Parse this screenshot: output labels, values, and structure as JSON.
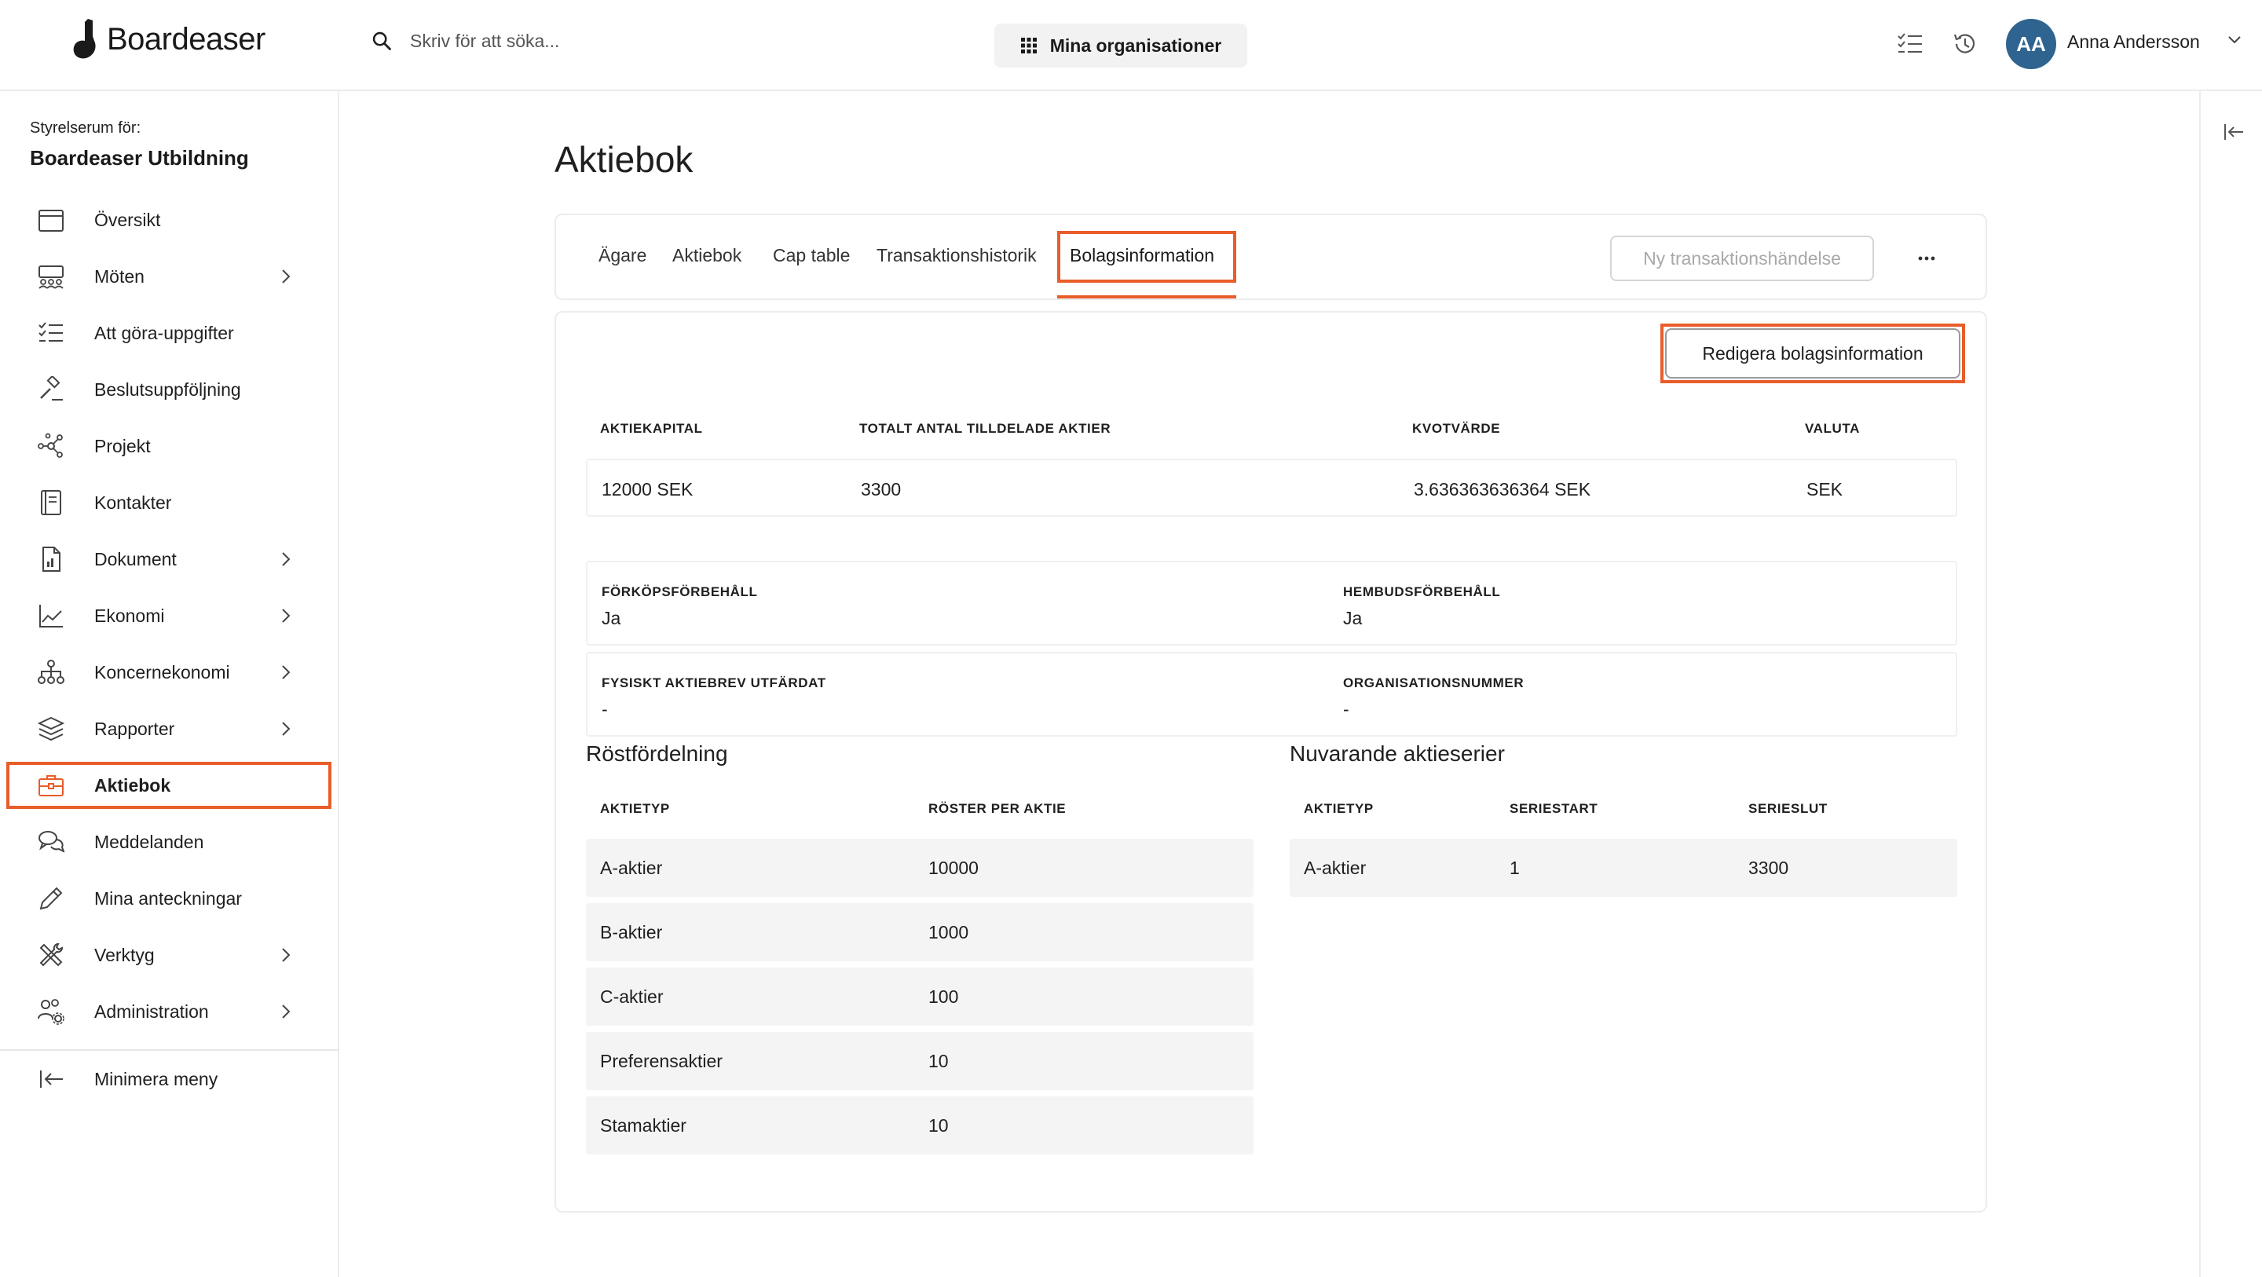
{
  "header": {
    "logo_text": "Boardeaser",
    "search_placeholder": "Skriv för att söka...",
    "org_button": "Mina organisationer",
    "user": {
      "initials": "AA",
      "name": "Anna Andersson",
      "avatar_color": "#2f6390"
    }
  },
  "sidebar": {
    "room_label": "Styrelserum för:",
    "room_name": "Boardeaser Utbildning",
    "items": [
      {
        "label": "Översikt",
        "icon": "calendar-icon",
        "has_chevron": false
      },
      {
        "label": "Möten",
        "icon": "meeting-icon",
        "has_chevron": true
      },
      {
        "label": "Att göra-uppgifter",
        "icon": "checklist-icon",
        "has_chevron": false
      },
      {
        "label": "Beslutsuppföljning",
        "icon": "gavel-icon",
        "has_chevron": false
      },
      {
        "label": "Projekt",
        "icon": "network-icon",
        "has_chevron": false
      },
      {
        "label": "Kontakter",
        "icon": "address-book-icon",
        "has_chevron": false
      },
      {
        "label": "Dokument",
        "icon": "document-icon",
        "has_chevron": true
      },
      {
        "label": "Ekonomi",
        "icon": "line-chart-icon",
        "has_chevron": true
      },
      {
        "label": "Koncernekonomi",
        "icon": "org-chart-icon",
        "has_chevron": true
      },
      {
        "label": "Rapporter",
        "icon": "layers-icon",
        "has_chevron": true
      },
      {
        "label": "Aktiebok",
        "icon": "briefcase-icon",
        "has_chevron": false,
        "active": true
      },
      {
        "label": "Meddelanden",
        "icon": "chat-icon",
        "has_chevron": false
      },
      {
        "label": "Mina anteckningar",
        "icon": "pencil-icon",
        "has_chevron": false
      },
      {
        "label": "Verktyg",
        "icon": "tools-icon",
        "has_chevron": true
      },
      {
        "label": "Administration",
        "icon": "users-gear-icon",
        "has_chevron": true
      }
    ],
    "minimize_label": "Minimera meny"
  },
  "main": {
    "title": "Aktiebok",
    "tabs": [
      {
        "label": "Ägare"
      },
      {
        "label": "Aktiebok"
      },
      {
        "label": "Cap table"
      },
      {
        "label": "Transaktionshistorik"
      },
      {
        "label": "Bolagsinformation",
        "active": true
      }
    ],
    "new_transaction_button": "Ny transaktionshändelse",
    "edit_button": "Redigera bolagsinformation",
    "capital_table": {
      "headers": [
        "AKTIEKAPITAL",
        "TOTALT ANTAL TILLDELADE AKTIER",
        "KVOTVÄRDE",
        "VALUTA"
      ],
      "row": [
        "12000 SEK",
        "3300",
        "3.636363636364 SEK",
        "SEK"
      ]
    },
    "info": {
      "forkop_label": "FÖRKÖPSFÖRBEHÅLL",
      "forkop_value": "Ja",
      "hembud_label": "HEMBUDSFÖRBEHÅLL",
      "hembud_value": "Ja",
      "fysiskt_label": "FYSISKT AKTIEBREV UTFÄRDAT",
      "fysiskt_value": "-",
      "orgnr_label": "ORGANISATIONSNUMMER",
      "orgnr_value": "-"
    },
    "vote_distribution": {
      "title": "Röstfördelning",
      "headers": [
        "AKTIETYP",
        "RÖSTER PER AKTIE"
      ],
      "rows": [
        [
          "A-aktier",
          "10000"
        ],
        [
          "B-aktier",
          "1000"
        ],
        [
          "C-aktier",
          "100"
        ],
        [
          "Preferensaktier",
          "10"
        ],
        [
          "Stamaktier",
          "10"
        ]
      ]
    },
    "share_series": {
      "title": "Nuvarande aktieserier",
      "headers": [
        "AKTIETYP",
        "SERIESTART",
        "SERIESLUT"
      ],
      "rows": [
        [
          "A-aktier",
          "1",
          "3300"
        ]
      ]
    }
  },
  "colors": {
    "highlight": "#e85d2a",
    "row_bg": "#f4f4f4",
    "border": "#ececec"
  }
}
